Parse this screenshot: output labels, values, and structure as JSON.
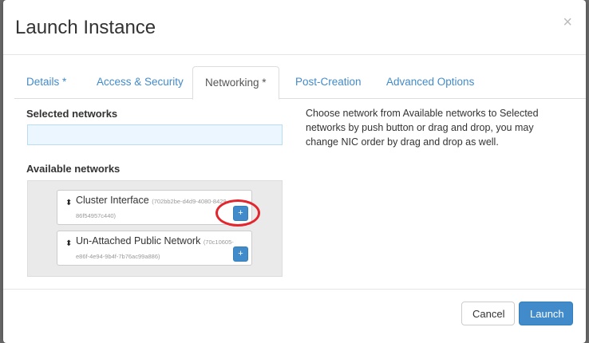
{
  "modal": {
    "title": "Launch Instance",
    "close_label": "×"
  },
  "tabs": [
    {
      "label": "Details *"
    },
    {
      "label": "Access & Security"
    },
    {
      "label": "Networking *"
    },
    {
      "label": "Post-Creation"
    },
    {
      "label": "Advanced Options"
    }
  ],
  "networking": {
    "selected_label": "Selected networks",
    "available_label": "Available networks",
    "help_text": "Choose network from Available networks to Selected networks by push button or drag and drop, you may change NIC order by drag and drop as well.",
    "networks": [
      {
        "name": "Cluster Interface",
        "id_part1": "(702bb2be-d4d9-4080-8429-",
        "id_part2": "86f54957c440)",
        "add_label": "+",
        "sort_icon": "⬍"
      },
      {
        "name": "Un-Attached Public Network",
        "id_part1": "(70c10605-",
        "id_part2": "e86f-4e94-9b4f-7b76ac99a886)",
        "add_label": "+",
        "sort_icon": "⬍"
      }
    ]
  },
  "footer": {
    "cancel_label": "Cancel",
    "launch_label": "Launch"
  },
  "colors": {
    "accent": "#428bca",
    "highlight": "#e3262e"
  }
}
